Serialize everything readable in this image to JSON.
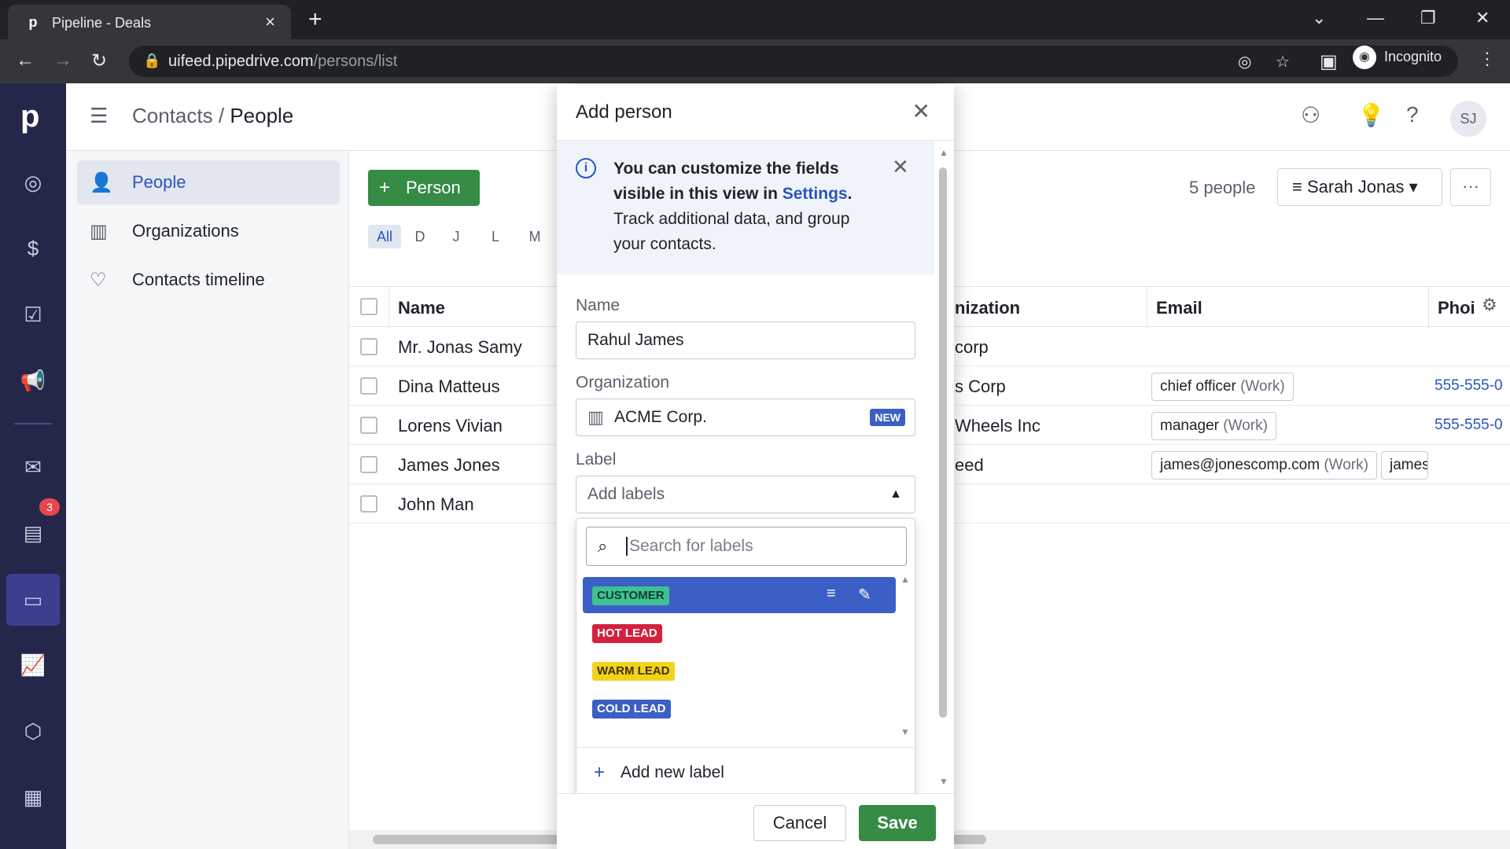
{
  "browser": {
    "tab_title": "Pipeline - Deals",
    "url_host": "uifeed.pipedrive.com",
    "url_path": "/persons/list",
    "incognito_label": "Incognito"
  },
  "app": {
    "logo": "p",
    "notification_count": "3",
    "breadcrumb_parent": "Contacts",
    "breadcrumb_sep": "/",
    "breadcrumb_current": "People",
    "avatar_initials": "SJ"
  },
  "sidebar": {
    "items": [
      {
        "label": "People",
        "icon": "person-icon"
      },
      {
        "label": "Organizations",
        "icon": "building-icon"
      },
      {
        "label": "Contacts timeline",
        "icon": "heart-pulse-icon"
      }
    ]
  },
  "toolbar": {
    "add_person_label": "Person",
    "people_count": "5 people",
    "filter_label": "Sarah Jonas",
    "more_label": "···"
  },
  "alpha_filter": [
    "All",
    "D",
    "J",
    "L",
    "M"
  ],
  "table": {
    "headers": {
      "name": "Name",
      "organization": "nization",
      "email": "Email",
      "phone": "Phoi"
    },
    "rows": [
      {
        "name": "Mr. Jonas Samy",
        "org": "corp",
        "email": "",
        "email_tag": "",
        "email2": "",
        "phone": ""
      },
      {
        "name": "Dina Matteus",
        "org": "s Corp",
        "email": "chief officer",
        "email_tag": "(Work)",
        "email2": "",
        "phone": "555-555-0"
      },
      {
        "name": "Lorens Vivian",
        "org": "Wheels Inc",
        "email": "manager",
        "email_tag": "(Work)",
        "email2": "",
        "phone": "555-555-0"
      },
      {
        "name": "James Jones",
        "org": "eed",
        "email": "james@jonescomp.com",
        "email_tag": "(Work)",
        "email2": "james",
        "phone": ""
      },
      {
        "name": "John Man",
        "org": "",
        "email": "",
        "email_tag": "",
        "email2": "",
        "phone": ""
      }
    ]
  },
  "modal": {
    "title": "Add person",
    "info_line1": "You can customize the fields visible in this view in ",
    "info_link": "Settings",
    "info_line2": "Track additional data, and group your contacts.",
    "name_label": "Name",
    "name_value": "Rahul James",
    "org_label": "Organization",
    "org_value": "ACME Corp.",
    "org_badge": "NEW",
    "label_label": "Label",
    "label_placeholder": "Add labels",
    "search_placeholder": "Search for labels",
    "labels": [
      {
        "text": "CUSTOMER",
        "bg": "#3fc191",
        "fg": "#0f3d2a"
      },
      {
        "text": "HOT LEAD",
        "bg": "#d4213d",
        "fg": "#ffffff"
      },
      {
        "text": "WARM LEAD",
        "bg": "#f2d21b",
        "fg": "#3d3300"
      },
      {
        "text": "COLD LEAD",
        "bg": "#3b5fc4",
        "fg": "#ffffff"
      }
    ],
    "add_label": "Add new label",
    "cancel_label": "Cancel",
    "save_label": "Save"
  }
}
